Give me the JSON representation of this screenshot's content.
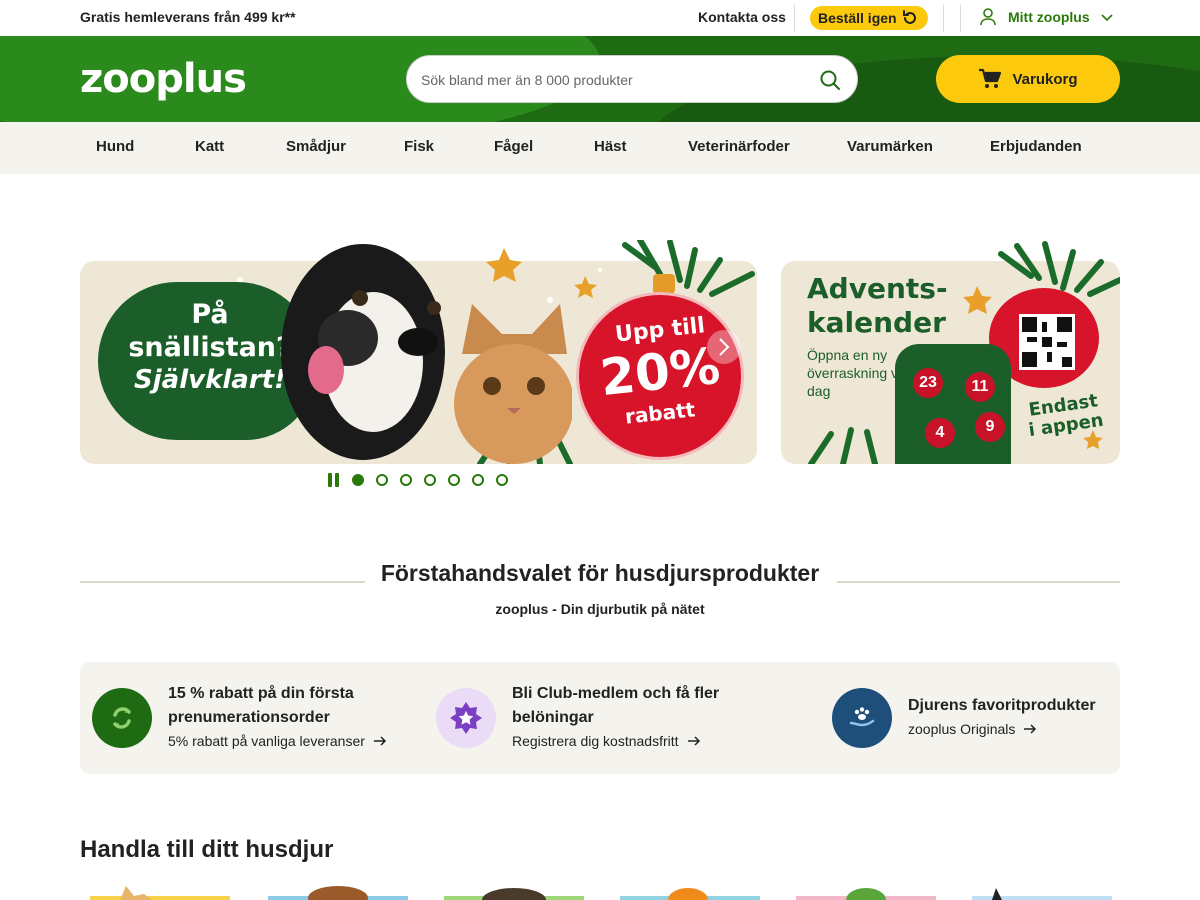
{
  "topbar": {
    "promo": "Gratis hemleverans från 499 kr**",
    "contact": "Kontakta oss",
    "reorder": "Beställ igen",
    "account": "Mitt zooplus"
  },
  "header": {
    "logo": "zooplus",
    "search_placeholder": "Sök bland mer än 8 000 produkter",
    "cart": "Varukorg"
  },
  "nav": {
    "items": [
      "Hund",
      "Katt",
      "Smådjur",
      "Fisk",
      "Fågel",
      "Häst",
      "Veterinärfoder",
      "Varumärken",
      "Erbjudanden"
    ]
  },
  "banners": {
    "main": {
      "bubble_line1": "På",
      "bubble_line2": "snällistan?",
      "bubble_line3": "Självklart!",
      "offer_line1": "Upp till",
      "offer_line2": "20%",
      "offer_line3": "rabatt"
    },
    "side": {
      "title_line1": "Advents-",
      "title_line2": "kalender",
      "subtitle": "Öppna en ny överraskning varje dag",
      "app_line1": "Endast",
      "app_line2": "i appen",
      "days": [
        "23",
        "11",
        "4",
        "9"
      ]
    }
  },
  "carousel": {
    "slides": 7,
    "active": 1
  },
  "section": {
    "title": "Förstahandsvalet för husdjursprodukter",
    "subtitle": "zooplus - Din djurbutik på nätet"
  },
  "benefits": [
    {
      "title": "15 % rabatt på din första prenumerationsorder",
      "link": "5% rabatt på vanliga leveranser",
      "icon": "subscription-icon",
      "color": "#1f6b14"
    },
    {
      "title": "Bli Club-medlem och få fler belöningar",
      "link": "Registrera dig kostnadsfritt",
      "icon": "club-star-icon",
      "color": "#7b3fc4"
    },
    {
      "title": "Djurens favoritprodukter",
      "link": "zooplus Originals",
      "icon": "paw-hand-icon",
      "color": "#1d4f7a"
    }
  ],
  "shop": {
    "title": "Handla till ditt husdjur"
  },
  "colors": {
    "brand_green": "#1f6b14",
    "accent_yellow": "#fcc90d",
    "link_green": "#2a7a0b",
    "offer_red": "#d7142a"
  }
}
